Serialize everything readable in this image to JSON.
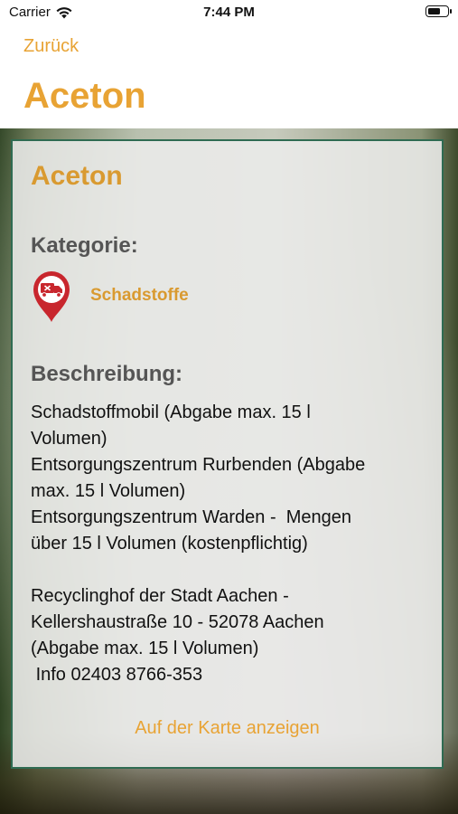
{
  "status_bar": {
    "carrier": "Carrier",
    "time": "7:44 PM",
    "battery_level": 0.7
  },
  "nav": {
    "back_label": "Zurück",
    "title": "Aceton"
  },
  "card": {
    "title": "Aceton",
    "category_heading": "Kategorie:",
    "category": {
      "name": "Schadstoffe",
      "icon": "hazardous-truck-pin-icon",
      "icon_color": "#c8262d"
    },
    "description_heading": "Beschreibung:",
    "description": "Schadstoffmobil (Abgabe max. 15 l\nVolumen)\nEntsorgungszentrum Rurbenden (Abgabe\nmax. 15 l Volumen)\nEntsorgungszentrum Warden -  Mengen\nüber 15 l Volumen (kostenpflichtig)\n\nRecyclinghof der Stadt Aachen -\nKellershaustraße 10 - 52078 Aachen\n(Abgabe max. 15 l Volumen)\n Info 02403 8766-353",
    "map_link_label": "Auf der Karte anzeigen"
  },
  "colors": {
    "accent": "#e8a334",
    "card_border": "#2f6b52"
  }
}
